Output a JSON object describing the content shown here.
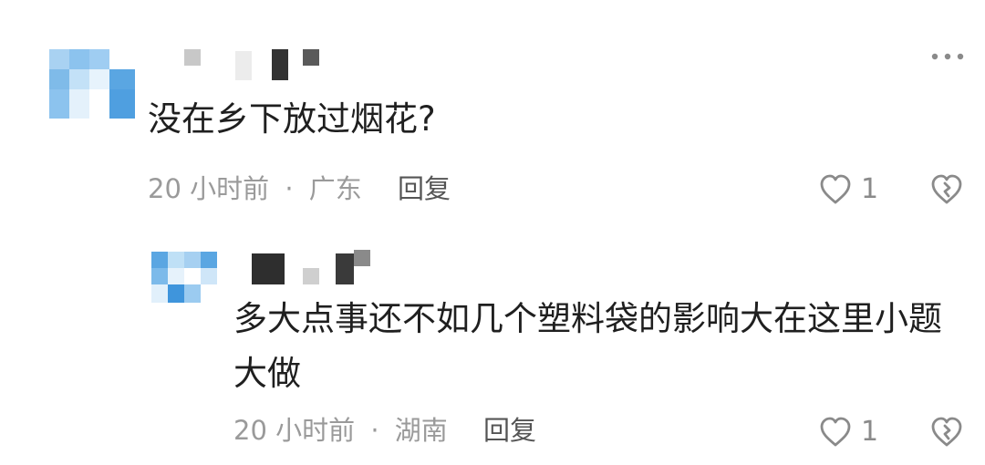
{
  "colors": {
    "text_primary": "#1f1f1f",
    "text_meta": "#9a9a9a",
    "reply_link": "#555555",
    "icon_gray": "#8a8a8a",
    "avatar_blue": "#6ab0e6"
  },
  "icons": {
    "more": "more-horizontal-icon",
    "like": "heart-outline-icon",
    "dislike": "broken-heart-icon"
  },
  "comment": {
    "text": "没在乡下放过烟花?",
    "time": "20 小时前",
    "separator": "·",
    "location": "广东",
    "reply_label": "回复",
    "likes": "1"
  },
  "reply": {
    "text_line1": "多大点事还不如几个塑料袋的影响大在这里小题",
    "text_line2": "大做",
    "time": "20 小时前",
    "separator": "·",
    "location": "湖南",
    "reply_label": "回复",
    "likes": "1"
  }
}
